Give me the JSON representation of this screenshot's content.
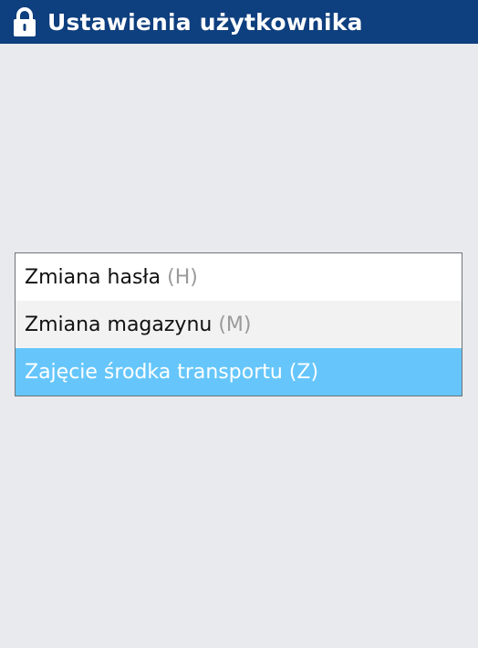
{
  "window": {
    "title": "Ustawienia użytkownika",
    "icon": "lock-icon"
  },
  "menu": {
    "items": [
      {
        "label": "Zmiana hasła",
        "shortcut": "(H)",
        "selected": false
      },
      {
        "label": "Zmiana magazynu",
        "shortcut": "(M)",
        "selected": false
      },
      {
        "label": "Zajęcie środka transportu",
        "shortcut": "(Z)",
        "selected": true
      }
    ]
  },
  "colors": {
    "titlebar": "#0e3f7e",
    "background": "#e9eaed",
    "selection": "#66c6fb",
    "shortcut": "#9a9a9a"
  }
}
